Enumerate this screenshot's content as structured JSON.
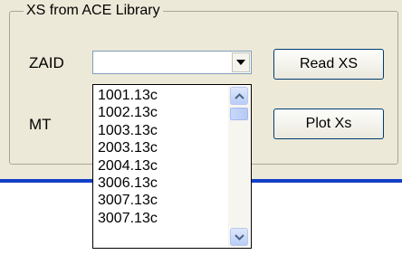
{
  "group": {
    "title": "XS from ACE Library"
  },
  "labels": {
    "zaid": "ZAID",
    "mt": "MT"
  },
  "combo": {
    "value": ""
  },
  "buttons": {
    "read": "Read XS",
    "plot": "Plot Xs"
  },
  "dropdown": {
    "items": [
      "1001.13c",
      "1002.13c",
      "1003.13c",
      "2003.13c",
      "2004.13c",
      "3006.13c",
      "3007.13c",
      "3007.13c"
    ]
  },
  "icons": {
    "combo_arrow": "chevron-down-icon",
    "scroll_up": "chevron-up-icon",
    "scroll_down": "chevron-down-icon"
  },
  "colors": {
    "window_bg": "#ece9d8",
    "accent_line": "#1340c8",
    "scroll_button": "#b9cdf6"
  }
}
